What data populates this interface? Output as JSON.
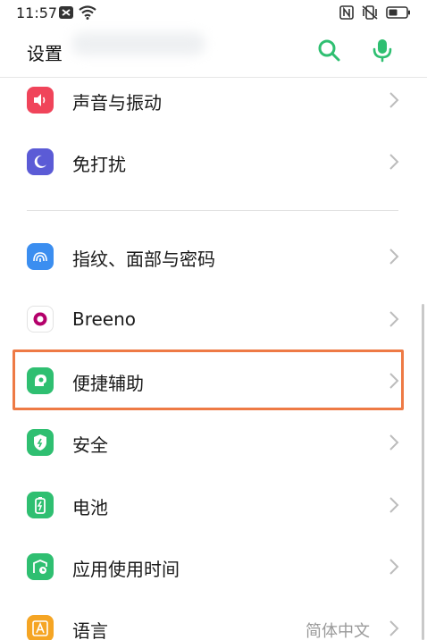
{
  "status_bar": {
    "time": "11:57",
    "icons_left": [
      "message-notification-icon",
      "wifi-icon"
    ],
    "icons_right": [
      "nfc-icon",
      "vibrate-icon",
      "battery-icon"
    ]
  },
  "header": {
    "title": "设置",
    "search_icon": "search-icon",
    "mic_icon": "microphone-icon",
    "accent_color": "#2fbf71"
  },
  "settings": {
    "items": [
      {
        "id": "sound",
        "label": "声音与振动",
        "icon": "speaker-icon",
        "color": "#f0445a"
      },
      {
        "id": "dnd",
        "label": "免打扰",
        "icon": "moon-icon",
        "color": "#5b5bd6"
      },
      {
        "id": "fingerprint",
        "label": "指纹、面部与密码",
        "icon": "face-fingerprint-icon",
        "color": "#3b8ef0"
      },
      {
        "id": "breeno",
        "label": "Breeno",
        "icon": "breeno-icon",
        "color": "#ffffff"
      },
      {
        "id": "accessibility",
        "label": "便捷辅助",
        "icon": "assist-icon",
        "color": "#2fbf71",
        "highlighted": true
      },
      {
        "id": "security",
        "label": "安全",
        "icon": "shield-icon",
        "color": "#2fbf71"
      },
      {
        "id": "battery",
        "label": "电池",
        "icon": "battery-icon",
        "color": "#2fbf71"
      },
      {
        "id": "app_usage",
        "label": "应用使用时间",
        "icon": "app-usage-icon",
        "color": "#2fbf71"
      },
      {
        "id": "language",
        "label": "语言",
        "icon": "language-icon",
        "color": "#f5a524",
        "value": "简体中文"
      }
    ]
  },
  "highlight_color": "#ee7a45"
}
